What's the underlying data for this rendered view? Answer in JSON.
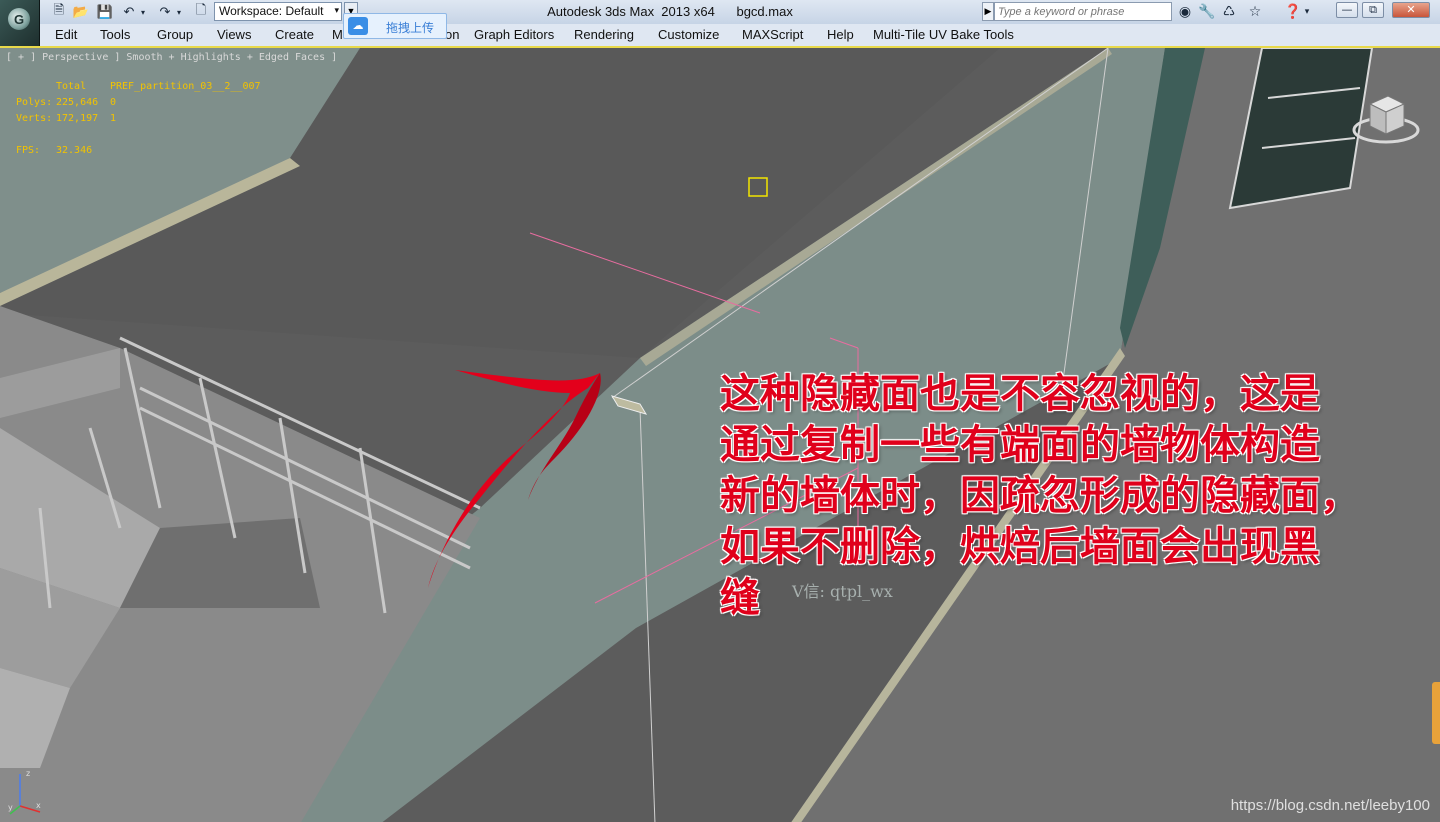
{
  "app": {
    "title": "Autodesk 3ds Max  2013 x64      bgcd.max",
    "logo_glyph": "G"
  },
  "toolbar": {
    "workspace_value": "Workspace: Default",
    "search_placeholder": "Type a keyword or phrase",
    "upload_overlay_label": "拖拽上传"
  },
  "menu": {
    "items": [
      "Edit",
      "Tools",
      "Group",
      "Views",
      "Create",
      "M",
      "on",
      "Graph Editors",
      "Rendering",
      "Customize",
      "MAXScript",
      "Help",
      "Multi-Tile UV Bake Tools"
    ]
  },
  "viewport": {
    "label": "[ + ] Perspective ] Smooth + Highlights + Edged Faces ]",
    "stats": {
      "header_total": "Total",
      "header_object": "PREF_partition_03__2__007",
      "polys_label": "Polys:",
      "polys_total": "225,646",
      "polys_object": "0",
      "verts_label": "Verts:",
      "verts_total": "172,197",
      "verts_object": "1",
      "fps_label": "FPS:",
      "fps_value": "32.346"
    },
    "axis_labels": {
      "z": "z",
      "x": "x",
      "y": "y"
    }
  },
  "annotation": {
    "lines": [
      "这种隐藏面也是不容忽视的，这是",
      "通过复制一些有端面的墙物体构造",
      "新的墙体时，因疏忽形成的隐藏面，",
      "如果不删除，烘焙后墙面会出现黑",
      "缝"
    ],
    "color": "#e0001b"
  },
  "watermarks": {
    "wechat": "V信: qtpl_wx",
    "blog": "https://blog.csdn.net/leeby100"
  },
  "colors": {
    "viewport_border": "#e8d94a",
    "stats_text": "#f2c300",
    "wall": "#7a8d88",
    "floor": "#5e5e5e"
  }
}
